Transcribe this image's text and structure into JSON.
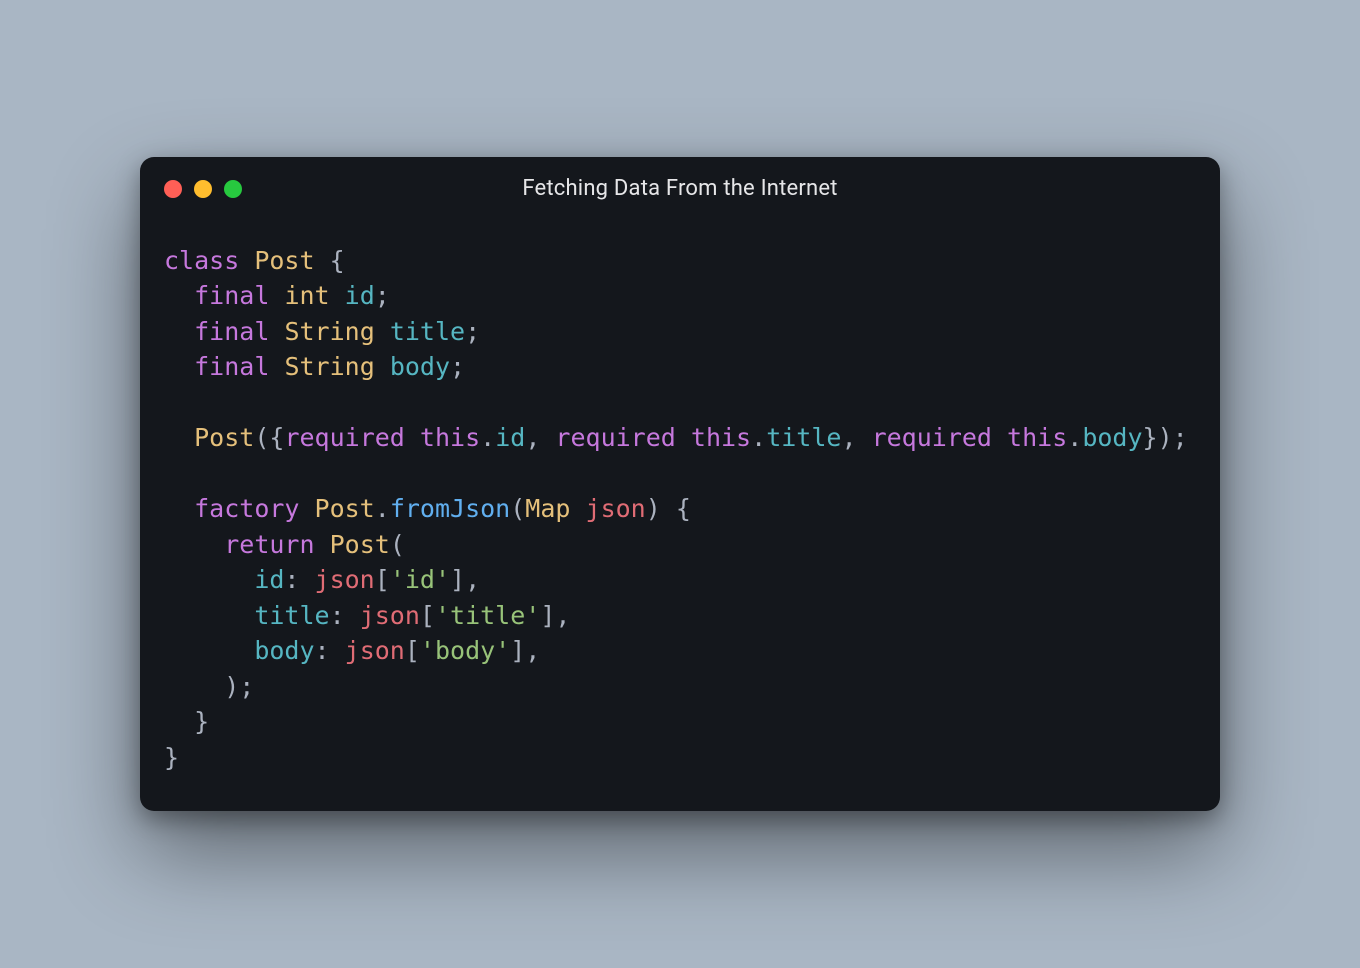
{
  "window": {
    "title": "Fetching Data From the Internet",
    "traffic_lights": {
      "red": "#ff5f56",
      "yellow": "#ffbd2e",
      "green": "#27c93f"
    }
  },
  "code": {
    "lines": [
      [
        {
          "cls": "tok-keyword",
          "t": "class"
        },
        {
          "cls": "tok-plain",
          "t": " "
        },
        {
          "cls": "tok-class",
          "t": "Post"
        },
        {
          "cls": "tok-plain",
          "t": " {"
        }
      ],
      [
        {
          "cls": "tok-plain",
          "t": "  "
        },
        {
          "cls": "tok-keyword",
          "t": "final"
        },
        {
          "cls": "tok-plain",
          "t": " "
        },
        {
          "cls": "tok-type",
          "t": "int"
        },
        {
          "cls": "tok-plain",
          "t": " "
        },
        {
          "cls": "tok-ident",
          "t": "id"
        },
        {
          "cls": "tok-plain",
          "t": ";"
        }
      ],
      [
        {
          "cls": "tok-plain",
          "t": "  "
        },
        {
          "cls": "tok-keyword",
          "t": "final"
        },
        {
          "cls": "tok-plain",
          "t": " "
        },
        {
          "cls": "tok-type",
          "t": "String"
        },
        {
          "cls": "tok-plain",
          "t": " "
        },
        {
          "cls": "tok-ident",
          "t": "title"
        },
        {
          "cls": "tok-plain",
          "t": ";"
        }
      ],
      [
        {
          "cls": "tok-plain",
          "t": "  "
        },
        {
          "cls": "tok-keyword",
          "t": "final"
        },
        {
          "cls": "tok-plain",
          "t": " "
        },
        {
          "cls": "tok-type",
          "t": "String"
        },
        {
          "cls": "tok-plain",
          "t": " "
        },
        {
          "cls": "tok-ident",
          "t": "body"
        },
        {
          "cls": "tok-plain",
          "t": ";"
        }
      ],
      [
        {
          "cls": "tok-plain",
          "t": ""
        }
      ],
      [
        {
          "cls": "tok-plain",
          "t": "  "
        },
        {
          "cls": "tok-class",
          "t": "Post"
        },
        {
          "cls": "tok-plain",
          "t": "({"
        },
        {
          "cls": "tok-keyword",
          "t": "required"
        },
        {
          "cls": "tok-plain",
          "t": " "
        },
        {
          "cls": "tok-builtin",
          "t": "this"
        },
        {
          "cls": "tok-plain",
          "t": "."
        },
        {
          "cls": "tok-ident",
          "t": "id"
        },
        {
          "cls": "tok-plain",
          "t": ", "
        },
        {
          "cls": "tok-keyword",
          "t": "required"
        },
        {
          "cls": "tok-plain",
          "t": " "
        },
        {
          "cls": "tok-builtin",
          "t": "this"
        },
        {
          "cls": "tok-plain",
          "t": "."
        },
        {
          "cls": "tok-ident",
          "t": "title"
        },
        {
          "cls": "tok-plain",
          "t": ", "
        },
        {
          "cls": "tok-keyword",
          "t": "required"
        },
        {
          "cls": "tok-plain",
          "t": " "
        },
        {
          "cls": "tok-builtin",
          "t": "this"
        },
        {
          "cls": "tok-plain",
          "t": "."
        },
        {
          "cls": "tok-ident",
          "t": "body"
        },
        {
          "cls": "tok-plain",
          "t": "});"
        }
      ],
      [
        {
          "cls": "tok-plain",
          "t": ""
        }
      ],
      [
        {
          "cls": "tok-plain",
          "t": "  "
        },
        {
          "cls": "tok-keyword",
          "t": "factory"
        },
        {
          "cls": "tok-plain",
          "t": " "
        },
        {
          "cls": "tok-class",
          "t": "Post"
        },
        {
          "cls": "tok-plain",
          "t": "."
        },
        {
          "cls": "tok-method",
          "t": "fromJson"
        },
        {
          "cls": "tok-plain",
          "t": "("
        },
        {
          "cls": "tok-type",
          "t": "Map"
        },
        {
          "cls": "tok-plain",
          "t": " "
        },
        {
          "cls": "tok-var",
          "t": "json"
        },
        {
          "cls": "tok-plain",
          "t": ") {"
        }
      ],
      [
        {
          "cls": "tok-plain",
          "t": "    "
        },
        {
          "cls": "tok-keyword",
          "t": "return"
        },
        {
          "cls": "tok-plain",
          "t": " "
        },
        {
          "cls": "tok-class",
          "t": "Post"
        },
        {
          "cls": "tok-plain",
          "t": "("
        }
      ],
      [
        {
          "cls": "tok-plain",
          "t": "      "
        },
        {
          "cls": "tok-ident",
          "t": "id"
        },
        {
          "cls": "tok-plain",
          "t": ": "
        },
        {
          "cls": "tok-var",
          "t": "json"
        },
        {
          "cls": "tok-plain",
          "t": "["
        },
        {
          "cls": "tok-string",
          "t": "'id'"
        },
        {
          "cls": "tok-plain",
          "t": "],"
        }
      ],
      [
        {
          "cls": "tok-plain",
          "t": "      "
        },
        {
          "cls": "tok-ident",
          "t": "title"
        },
        {
          "cls": "tok-plain",
          "t": ": "
        },
        {
          "cls": "tok-var",
          "t": "json"
        },
        {
          "cls": "tok-plain",
          "t": "["
        },
        {
          "cls": "tok-string",
          "t": "'title'"
        },
        {
          "cls": "tok-plain",
          "t": "],"
        }
      ],
      [
        {
          "cls": "tok-plain",
          "t": "      "
        },
        {
          "cls": "tok-ident",
          "t": "body"
        },
        {
          "cls": "tok-plain",
          "t": ": "
        },
        {
          "cls": "tok-var",
          "t": "json"
        },
        {
          "cls": "tok-plain",
          "t": "["
        },
        {
          "cls": "tok-string",
          "t": "'body'"
        },
        {
          "cls": "tok-plain",
          "t": "],"
        }
      ],
      [
        {
          "cls": "tok-plain",
          "t": "    );"
        }
      ],
      [
        {
          "cls": "tok-plain",
          "t": "  }"
        }
      ],
      [
        {
          "cls": "tok-plain",
          "t": "}"
        }
      ]
    ]
  }
}
